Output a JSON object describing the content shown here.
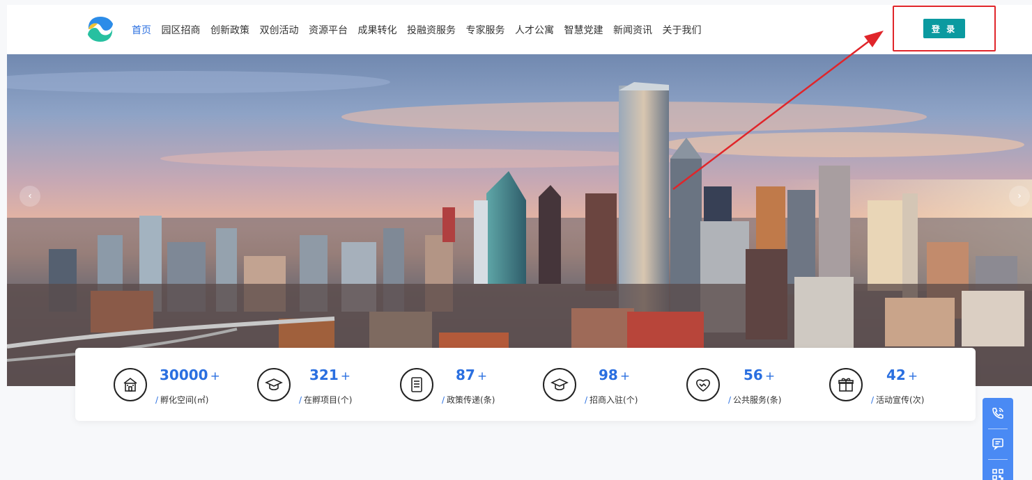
{
  "nav": {
    "items": [
      "首页",
      "园区招商",
      "创新政策",
      "双创活动",
      "资源平台",
      "成果转化",
      "投融资服务",
      "专家服务",
      "人才公寓",
      "智慧党建",
      "新闻资讯",
      "关于我们"
    ],
    "active_index": 0
  },
  "header": {
    "login_label": "登 录"
  },
  "hero": {
    "prev_glyph": "‹",
    "next_glyph": "›"
  },
  "stats": [
    {
      "value": "30000",
      "suffix": "+",
      "label": "孵化空间(㎡)",
      "icon": "building-icon"
    },
    {
      "value": "321",
      "suffix": "+",
      "label": "在孵项目(个)",
      "icon": "graduation-cap-icon"
    },
    {
      "value": "87",
      "suffix": "+",
      "label": "政策传递(条)",
      "icon": "document-icon"
    },
    {
      "value": "98",
      "suffix": "+",
      "label": "招商入驻(个)",
      "icon": "graduation-cap-icon"
    },
    {
      "value": "56",
      "suffix": "+",
      "label": "公共服务(条)",
      "icon": "handshake-icon"
    },
    {
      "value": "42",
      "suffix": "+",
      "label": "活动宣传(次)",
      "icon": "gift-icon"
    }
  ],
  "stat_slash": "/",
  "side_bar": {
    "items": [
      "phone-icon",
      "message-icon",
      "qrcode-icon"
    ]
  },
  "colors": {
    "accent": "#2a6fe0",
    "login": "#0b9aa0",
    "annotation": "#e0252a",
    "side": "#4a8af4"
  }
}
